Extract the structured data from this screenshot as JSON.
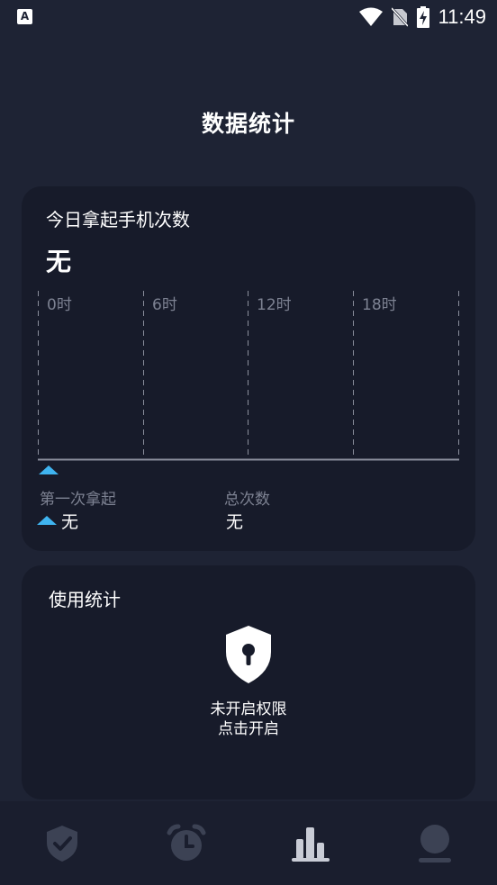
{
  "status_bar": {
    "app_icon_letter": "A",
    "time": "11:49",
    "icons": [
      "wifi-icon",
      "no-sim-icon",
      "battery-charging-icon"
    ]
  },
  "page_title": "数据统计",
  "pickup_card": {
    "title": "今日拿起手机次数",
    "count": "无",
    "ticks": [
      "0时",
      "6时",
      "12时",
      "18时"
    ],
    "first_pickup_label": "第一次拿起",
    "first_pickup_value": "无",
    "total_label": "总次数",
    "total_value": "无"
  },
  "usage_card": {
    "title": "使用统计",
    "lock_icon": "shield-lock-icon",
    "permission_line1": "未开启权限",
    "permission_line2": "点击开启"
  },
  "tabbar": {
    "tabs": [
      {
        "icon": "shield-check-icon",
        "active": false
      },
      {
        "icon": "alarm-clock-icon",
        "active": false
      },
      {
        "icon": "bar-chart-icon",
        "active": true
      },
      {
        "icon": "profile-icon",
        "active": false
      }
    ]
  },
  "colors": {
    "accent": "#3fb4f0",
    "background": "#1e2334",
    "card": "#171b2a"
  }
}
